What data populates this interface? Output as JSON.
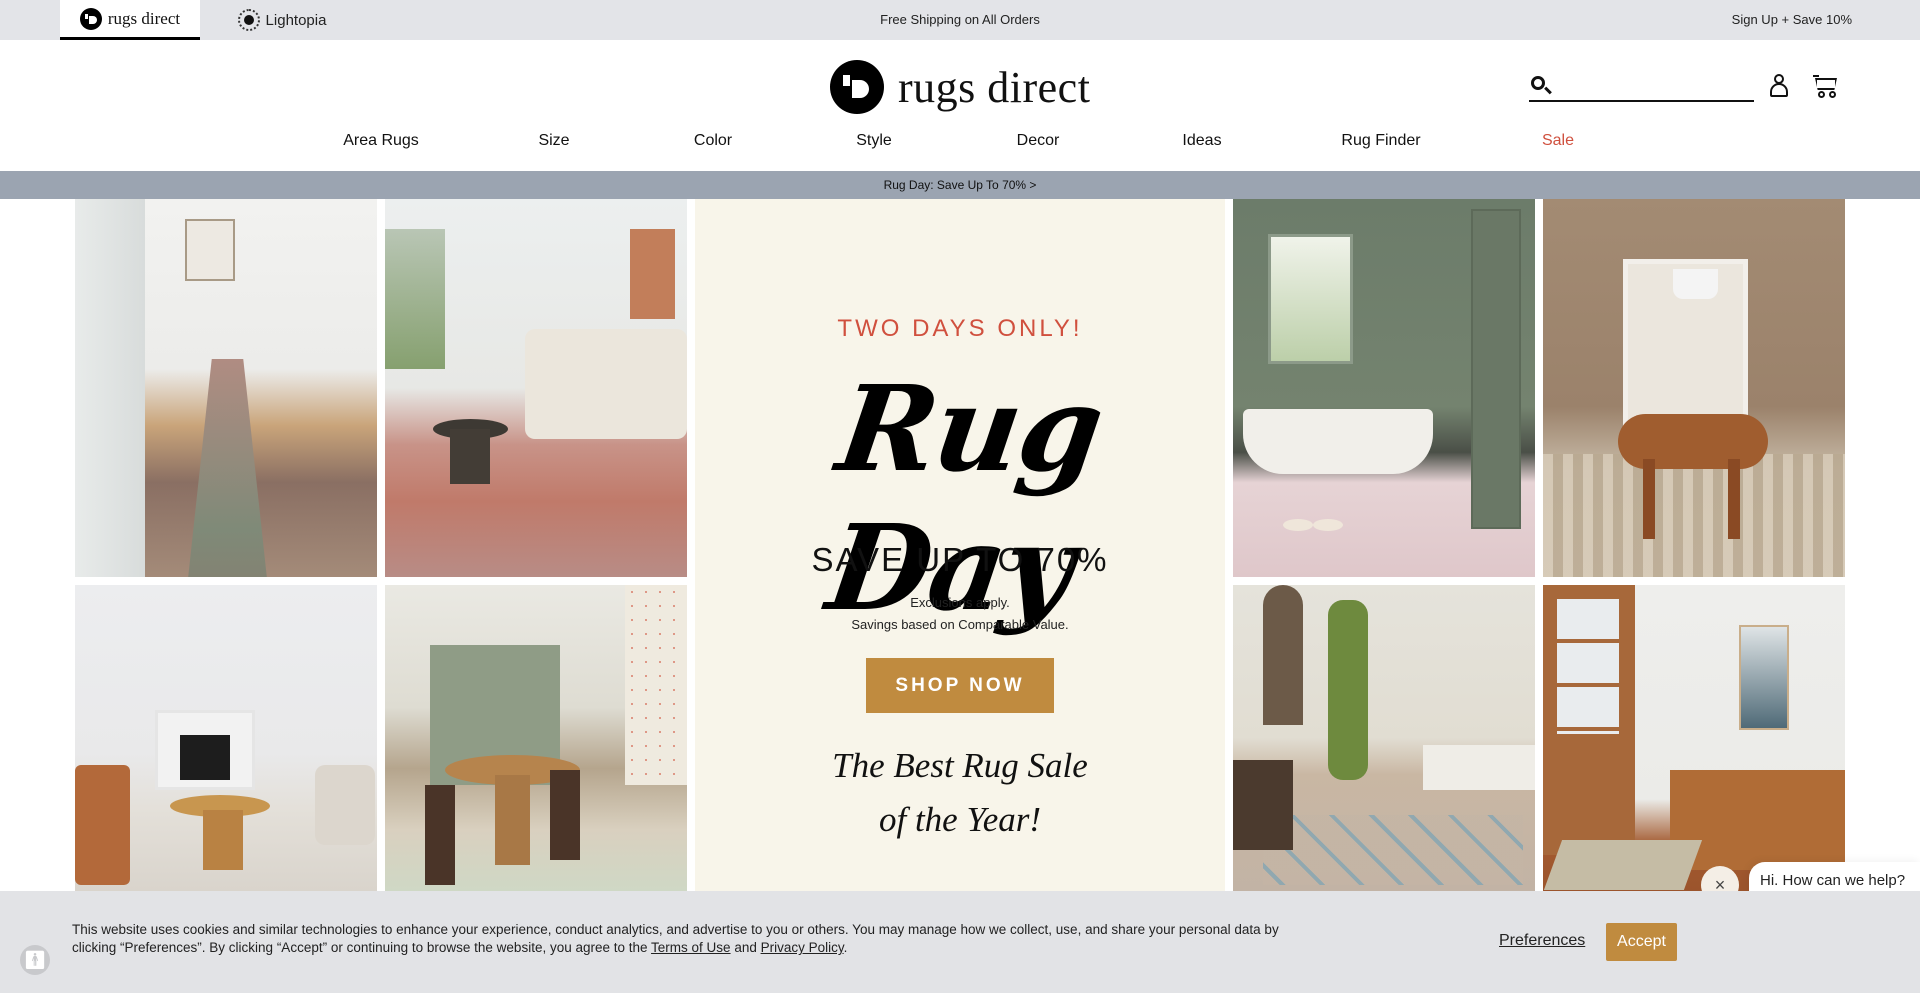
{
  "topbar": {
    "brands": [
      {
        "label": "rugs direct",
        "active": true
      },
      {
        "label": "Lightopia",
        "active": false
      }
    ],
    "shipping": "Free Shipping on All Orders",
    "signup": "Sign Up + Save 10%"
  },
  "header": {
    "logo_text": "rugs direct",
    "search_placeholder": "",
    "search_value": ""
  },
  "nav": {
    "items": [
      "Area Rugs",
      "Size",
      "Color",
      "Style",
      "Decor",
      "Ideas",
      "Rug Finder",
      "Sale"
    ],
    "sale_color": "#d0503e"
  },
  "promo_bar": "Rug Day: Save Up To 70% >",
  "hero": {
    "kicker": "TWO DAYS ONLY!",
    "title": "Rug Day",
    "headline": "SAVE UP TO 70%",
    "fine_print_1": "Exclusions apply.",
    "fine_print_2": "Savings based on Comparable Value.",
    "cta": "SHOP NOW",
    "tagline_1": "The Best Rug Sale",
    "tagline_2": "of the Year!",
    "accent_color": "#c08b3f",
    "background": "#f8f5ea"
  },
  "images": [
    {
      "alt": "hallway-runner-rug"
    },
    {
      "alt": "living-room-red-rug"
    },
    {
      "alt": "living-room-fireplace-rug"
    },
    {
      "alt": "kitchen-dining-floral-rug"
    },
    {
      "alt": "green-bathroom-floral-rug"
    },
    {
      "alt": "dining-room-checkered-rug"
    },
    {
      "alt": "patio-blue-diamond-rug"
    },
    {
      "alt": "entryway-vintage-rug"
    }
  ],
  "cookie": {
    "text_1": "This website uses cookies and similar technologies to enhance your experience, conduct analytics, and advertise to you or others. You may manage how we collect, use, and share your personal data by clicking “Preferences”. By clicking “Accept” or continuing to browse the website, you agree to the ",
    "terms": "Terms of Use",
    "and": " and ",
    "privacy": "Privacy Policy",
    "end": ".",
    "preferences": "Preferences",
    "accept": "Accept"
  },
  "chat": {
    "prompt": "Hi. How can we help?",
    "close": "×"
  },
  "a11y_icon": "accessibility-icon"
}
